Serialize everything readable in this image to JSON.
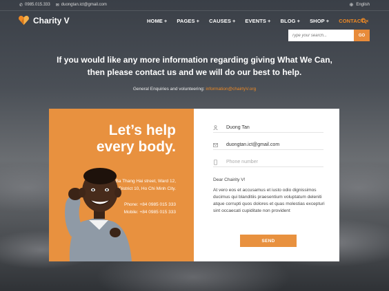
{
  "topbar": {
    "phone": "0985.015.333",
    "email": "duongtan.ict@gmail.com",
    "language": "English"
  },
  "brand": {
    "name": "Charity V"
  },
  "nav": {
    "items": [
      {
        "label": "HOME",
        "suffix": "+"
      },
      {
        "label": "PAGES",
        "suffix": "+"
      },
      {
        "label": "CAUSES",
        "suffix": "+"
      },
      {
        "label": "EVENTS",
        "suffix": "+"
      },
      {
        "label": "BLOG",
        "suffix": "+"
      },
      {
        "label": "SHOP",
        "suffix": "+"
      },
      {
        "label": "CONTACT",
        "suffix": "×"
      }
    ],
    "active": "CONTACT"
  },
  "search": {
    "placeholder": "Type your search...",
    "button": "GO"
  },
  "hero": {
    "line1": "If you would like any more information regarding giving What We Can,",
    "line2": "then please contact us and we will do our best to help.",
    "enquiry_label": "General Enquiries and volunteering:",
    "enquiry_email": "information@chairtyV.org"
  },
  "card": {
    "heading_line1": "Let’s help",
    "heading_line2": "every body.",
    "address_line1": "Ba Thang Hai street, Ward 12,",
    "address_line2": "District 10, Ho Chi Minh City.",
    "phone": "Phone: +84 0985 015 333",
    "mobile": "Mobile: +84 0985 015 333"
  },
  "form": {
    "name_value": "Duong Tan",
    "email_value": "duongtan.ict@gmail.com",
    "phone_placeholder": "Phone number",
    "greeting": "Dear Chairity V!",
    "message": "At vero eos et accusamus et iusto odio dignissimos ducimus qui blanditiis praesentium voluptatum deleniti atque corrupti quos dolores et quas molestias excepturi sint occaecati cupiditate non provident",
    "send_label": "SEND"
  },
  "colors": {
    "accent": "#e8913f",
    "nav_active": "#f08a24"
  },
  "icons": {
    "phone": "phone-icon",
    "mail": "mail-icon",
    "globe": "globe-icon",
    "search": "search-icon",
    "user": "user-icon",
    "mobile": "mobile-icon"
  }
}
